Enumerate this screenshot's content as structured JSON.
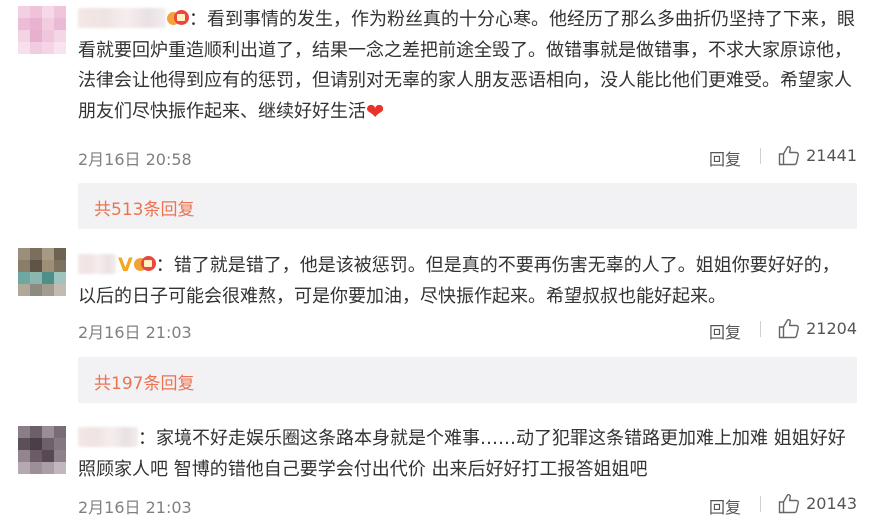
{
  "comments": [
    {
      "text": "：看到事情的发生，作为粉丝真的十分心寒。他经历了那么多曲折仍坚持了下来，眼看就要回炉重造顺利出道了，结果一念之差把前途全毁了。做错事就是做错事，不求大家原谅他，法律会让他得到应有的惩罚，但请别对无辜的家人朋友恶语相向，没人能比他们更难受。希望家人朋友们尽快振作起来、继续好好生活",
      "date": "2月16日 20:58",
      "reply_label": "回复",
      "likes": "21441",
      "replies_label": "共513条回复"
    },
    {
      "text": "：错了就是错了，他是该被惩罚。但是真的不要再伤害无辜的人了。姐姐你要好好的，以后的日子可能会很难熬，可是你要加油，尽快振作起来。希望叔叔也能好起来。",
      "date": "2月16日 21:03",
      "reply_label": "回复",
      "likes": "21204",
      "replies_label": "共197条回复"
    },
    {
      "text": "：家境不好走娱乐圈这条路本身就是个难事……动了犯罪这条错路更加难上加难 姐姐好好照顾家人吧 智博的错他自己要学会付出代价 出来后好好打工报答姐姐吧",
      "date": "2月16日 21:03",
      "reply_label": "回复",
      "likes": "20143"
    }
  ],
  "icons": {
    "heart": "red-heart-icon",
    "like": "thumbs-up-icon",
    "verified": "yellow-v-icon",
    "fan_badge": "fan-badge-icon"
  },
  "colors": {
    "replies_link": "#eb7350",
    "meta_text": "#808080",
    "body_text": "#333333",
    "replies_bg": "#f2f2f5",
    "heart": "#e8322b",
    "verified": "#f5a623"
  }
}
